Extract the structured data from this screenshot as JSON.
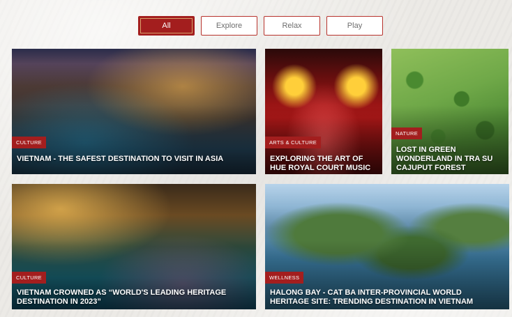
{
  "filters": [
    {
      "label": "All",
      "active": true
    },
    {
      "label": "Explore",
      "active": false
    },
    {
      "label": "Relax",
      "active": false
    },
    {
      "label": "Play",
      "active": false
    }
  ],
  "cards": [
    {
      "category": "Culture",
      "title": "Vietnam - The Safest Destination to Visit in Asia"
    },
    {
      "category": "Arts & Culture",
      "title": "Exploring the Art of Hue Royal Court Music"
    },
    {
      "category": "Nature",
      "title": "Lost in Green Wonderland in Tra Su Cajuput Forest"
    },
    {
      "category": "Culture",
      "title": "Vietnam Crowned as “World's Leading Heritage Destination in 2023”"
    },
    {
      "category": "Wellness",
      "title": "Halong Bay - Cat Ba Inter-Provincial World Heritage Site: Trending Destination in Vietnam"
    }
  ],
  "colors": {
    "accent": "#a31e1e",
    "page_bg": "#eceae6"
  }
}
